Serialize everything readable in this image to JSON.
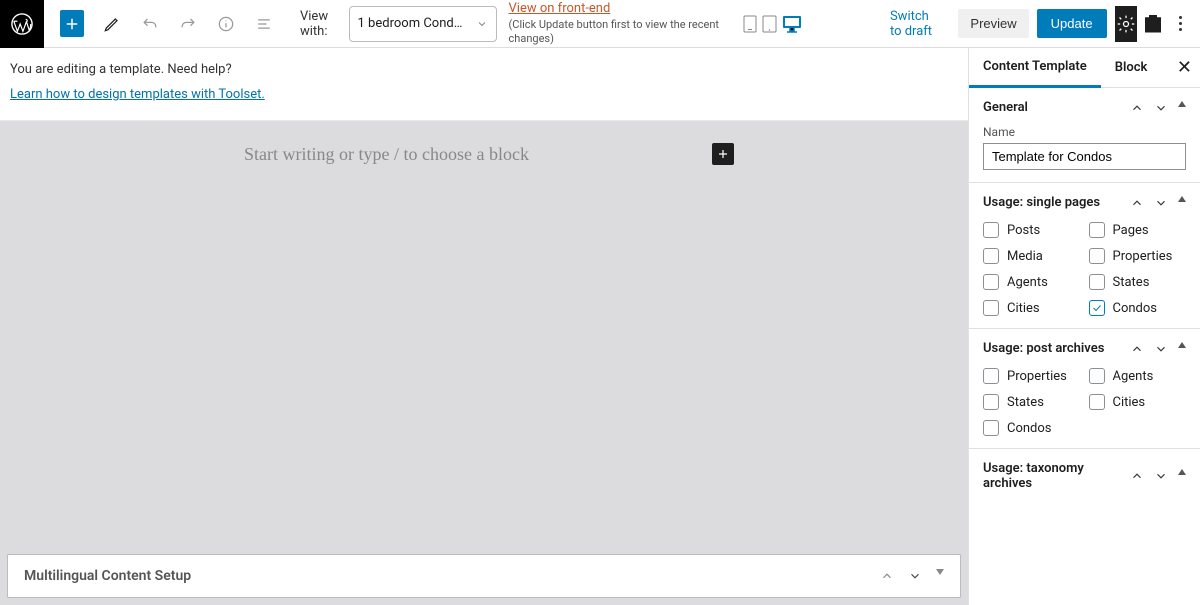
{
  "topbar": {
    "viewwith_label": "View with:",
    "viewwith_value": "1 bedroom Condo i…",
    "frontend_link": "View on front-end",
    "frontend_note": "(Click Update button first to view the recent changes)",
    "switch_draft": "Switch to draft",
    "preview": "Preview",
    "update": "Update"
  },
  "info": {
    "question": "You are editing a template. Need help?",
    "learn_link": "Learn how to design templates with Toolset."
  },
  "canvas": {
    "placeholder": "Start writing or type / to choose a block"
  },
  "footer": {
    "title": "Multilingual Content Setup"
  },
  "sidebar": {
    "tabs": {
      "content_template": "Content Template",
      "block": "Block"
    },
    "general": {
      "title": "General",
      "name_label": "Name",
      "name_value": "Template for Condos"
    },
    "usage_single": {
      "title": "Usage: single pages",
      "items": [
        {
          "label": "Posts",
          "checked": false
        },
        {
          "label": "Pages",
          "checked": false
        },
        {
          "label": "Media",
          "checked": false
        },
        {
          "label": "Properties",
          "checked": false
        },
        {
          "label": "Agents",
          "checked": false
        },
        {
          "label": "States",
          "checked": false
        },
        {
          "label": "Cities",
          "checked": false
        },
        {
          "label": "Condos",
          "checked": true
        }
      ]
    },
    "usage_archives": {
      "title": "Usage: post archives",
      "items": [
        {
          "label": "Properties",
          "checked": false
        },
        {
          "label": "Agents",
          "checked": false
        },
        {
          "label": "States",
          "checked": false
        },
        {
          "label": "Cities",
          "checked": false
        },
        {
          "label": "Condos",
          "checked": false
        }
      ]
    },
    "usage_tax": {
      "title": "Usage: taxonomy archives"
    }
  }
}
